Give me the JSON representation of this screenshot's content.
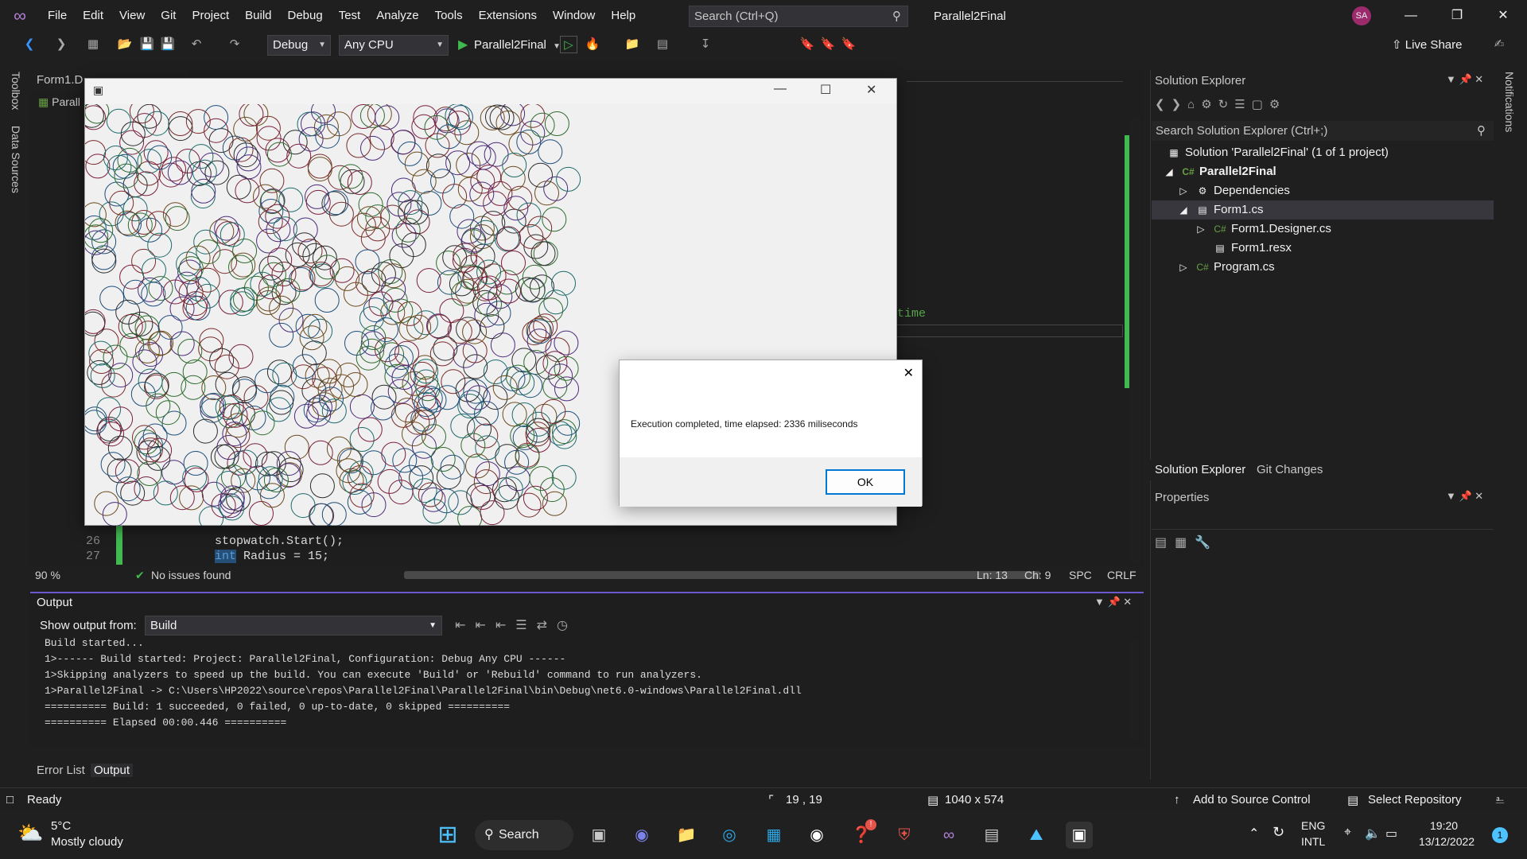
{
  "titlebar": {
    "menus": [
      "File",
      "Edit",
      "View",
      "Git",
      "Project",
      "Build",
      "Debug",
      "Test",
      "Analyze",
      "Tools",
      "Extensions",
      "Window",
      "Help"
    ],
    "search_placeholder": "Search (Ctrl+Q)",
    "solution_name": "Parallel2Final",
    "avatar_initials": "SA"
  },
  "toolbar": {
    "config": "Debug",
    "platform": "Any CPU",
    "run_target": "Parallel2Final",
    "live_share": "Live Share"
  },
  "side_tabs": {
    "toolbox": "Toolbox",
    "data_sources": "Data Sources",
    "notifications": "Notifications"
  },
  "editor": {
    "doc_tab": "Form1.D",
    "nav_tab": "Parall",
    "line_26": "26",
    "line_27": "27",
    "code_26": "stopwatch.Start();",
    "code_27_kw": "int",
    "code_27_rest": " Radius = 15;",
    "partial_comment": "time",
    "zoom": "90 %",
    "issues": "No issues found",
    "ln": "Ln: 13",
    "ch": "Ch: 9",
    "spc": "SPC",
    "crlf": "CRLF"
  },
  "solution_explorer": {
    "title": "Solution Explorer",
    "search_placeholder": "Search Solution Explorer (Ctrl+;)",
    "items": [
      {
        "label": "Solution 'Parallel2Final' (1 of 1 project)"
      },
      {
        "label": "Parallel2Final"
      },
      {
        "label": "Dependencies"
      },
      {
        "label": "Form1.cs"
      },
      {
        "label": "Form1.Designer.cs"
      },
      {
        "label": "Form1.resx"
      },
      {
        "label": "Program.cs"
      }
    ],
    "tab_1": "Solution Explorer",
    "tab_2": "Git Changes",
    "properties_title": "Properties"
  },
  "output": {
    "title": "Output",
    "show_from_label": "Show output from:",
    "source": "Build",
    "lines": [
      "Build started...",
      "1>------ Build started: Project: Parallel2Final, Configuration: Debug Any CPU ------",
      "1>Skipping analyzers to speed up the build. You can execute 'Build' or 'Rebuild' command to run analyzers.",
      "1>Parallel2Final -> C:\\Users\\HP2022\\source\\repos\\Parallel2Final\\Parallel2Final\\bin\\Debug\\net6.0-windows\\Parallel2Final.dll",
      "========== Build: 1 succeeded, 0 failed, 0 up-to-date, 0 skipped ==========",
      "========== Elapsed 00:00.446 =========="
    ],
    "tab_error_list": "Error List",
    "tab_output": "Output"
  },
  "statusbar": {
    "ready": "Ready",
    "position": "19 , 19",
    "size": "1040 x 574",
    "add_source": "Add to Source Control",
    "select_repo": "Select Repository"
  },
  "msgbox": {
    "text": "Execution completed, time elapsed: 2336 miliseconds",
    "ok": "OK"
  },
  "taskbar": {
    "temp": "5°C",
    "weather": "Mostly cloudy",
    "search": "Search",
    "lang_1": "ENG",
    "lang_2": "INTL",
    "time": "19:20",
    "date": "13/12/2022",
    "badge": "1"
  },
  "colors": {
    "accent": "#6a5acd",
    "run_green": "#3fb950",
    "circle_palette": [
      "#2b2b2b",
      "#7a1f3d",
      "#1f4f7a",
      "#2e6b2e",
      "#6b4a1f",
      "#4b2b7a",
      "#1f6b6b",
      "#7a2b2b"
    ]
  }
}
